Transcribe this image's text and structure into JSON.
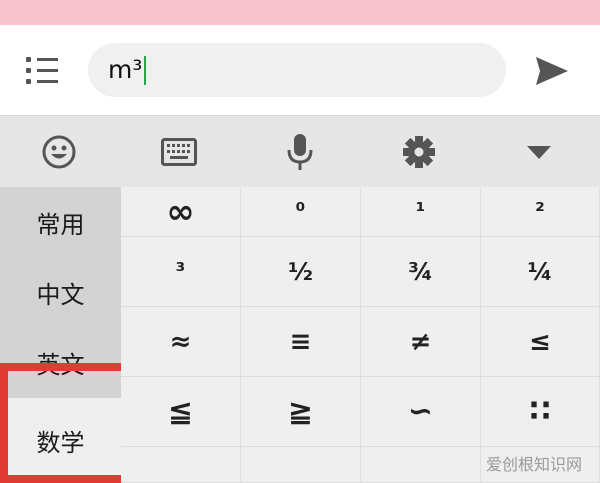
{
  "input": {
    "value": "m³"
  },
  "toolbar": {
    "buttons": [
      {
        "icon": "emoji-icon"
      },
      {
        "icon": "keyboard-icon"
      },
      {
        "icon": "microphone-icon"
      },
      {
        "icon": "settings-icon"
      },
      {
        "icon": "collapse-arrow-icon"
      }
    ]
  },
  "categories": [
    "常用",
    "中文",
    "英文",
    "数学"
  ],
  "active_category": "数学",
  "symbols": [
    [
      "∞",
      "⁰",
      "¹",
      "²"
    ],
    [
      "³",
      "½",
      "¾",
      "¼"
    ],
    [
      "≈",
      "≡",
      "≠",
      "≤"
    ],
    [
      "≦",
      "≧",
      "∽",
      "∷"
    ]
  ],
  "watermark": "爱创根知识网",
  "colors": {
    "top_bar": "#f8c3cc",
    "caret": "#2aa64a",
    "highlight": "#e13b33"
  }
}
